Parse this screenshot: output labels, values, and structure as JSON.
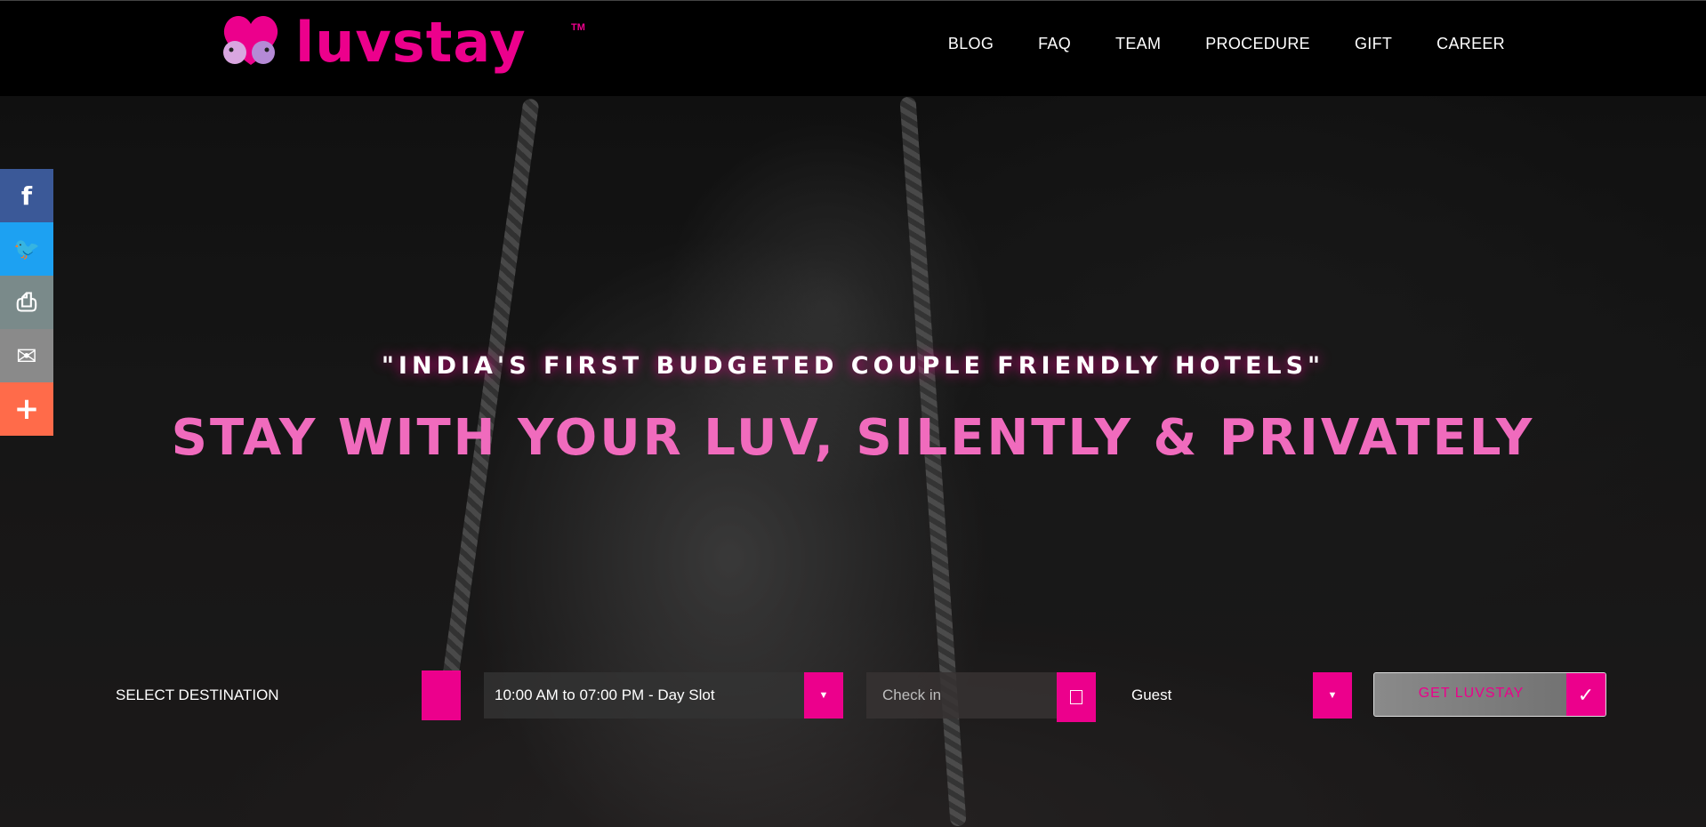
{
  "header": {
    "logo_text": "luvstay",
    "logo_tm": "TM",
    "nav": [
      "BLOG",
      "FAQ",
      "TEAM",
      "PROCEDURE",
      "GIFT",
      "CAREER"
    ]
  },
  "hero": {
    "tagline": "\"INDIA'S FIRST BUDGETED COUPLE FRIENDLY HOTELS\"",
    "headline": "STAY WITH YOUR LUV, SILENTLY & PRIVATELY"
  },
  "booking": {
    "destination_label": "SELECT DESTINATION",
    "slot_value": "10:00 AM to 07:00 PM - Day Slot",
    "checkin_placeholder": "Check in",
    "guest_value": "Guest",
    "submit_label": "GET LUVSTAY"
  },
  "social": {
    "items": [
      {
        "name": "facebook",
        "glyph": "f",
        "color": "#3b5998"
      },
      {
        "name": "twitter",
        "glyph": "🐦",
        "color": "#1da1f2"
      },
      {
        "name": "print",
        "glyph": "⎙",
        "color": "#7a8a8a"
      },
      {
        "name": "email",
        "glyph": "✉",
        "color": "#8a8a8a"
      },
      {
        "name": "more",
        "glyph": "+",
        "color": "#ff6b4a"
      }
    ]
  },
  "colors": {
    "brand": "#ec008c",
    "headline": "#f06bbd"
  }
}
